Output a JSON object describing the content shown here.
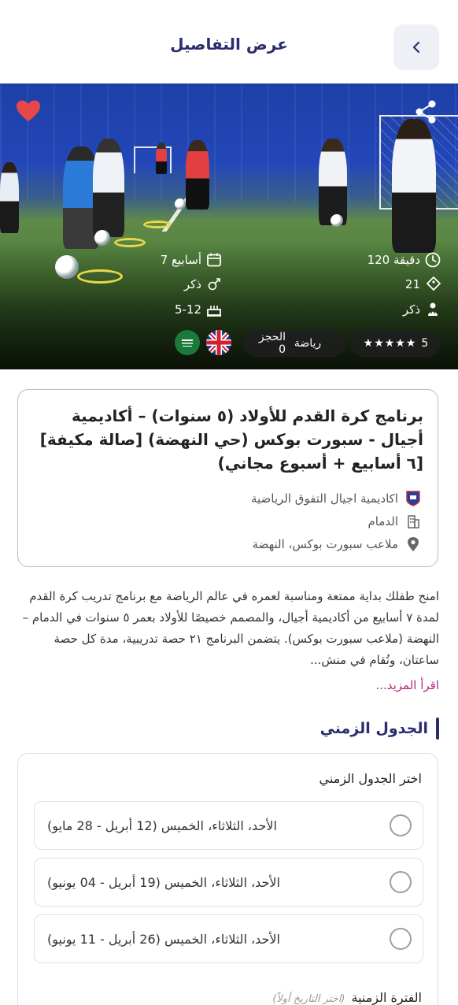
{
  "header": {
    "title": "عرض التفاصيل",
    "back_icon": "chevron-left-icon"
  },
  "hero": {
    "duration": "120 دقيقة",
    "weeks": "7 أسابيع",
    "count": "21",
    "gender_1": "ذكر",
    "gender_2": "ذكر",
    "age_range": "5-12",
    "rating": "5",
    "stars": "★★★★★",
    "category": "رياضة",
    "bookings": "الحجز 0",
    "favorite_color": "#e8474a"
  },
  "info": {
    "title": "برنامج كرة القدم للأولاد (٥ سنوات) – أكاديمية أجيال - سبورت بوكس (حي النهضة) [صالة مكيفة] [٦ أسابيع + أسبوع مجاني)",
    "academy": "اكاديمية اجيال التفوق الرياضية",
    "city": "الدمام",
    "venue": "ملاعب سبورت بوكس، النهضة"
  },
  "description": {
    "text": "امنح طفلك بداية ممتعة ومناسبة لعمره في عالم الرياضة مع برنامج تدريب كرة القدم لمدة ٧ أسابيع من أكاديمية أجيال، والمصمم خصيصًا للأولاد بعمر ٥ سنوات في الدمام – النهضة (ملاعب سبورت بوكس). يتضمن البرنامج ٢١ حصة تدريبية، مدة كل حصة ساعتان، وتُقام في منش...",
    "read_more": "اقرأ المزيد..."
  },
  "schedule": {
    "section_title": "الجدول الزمني",
    "choose_label": "اختر الجدول الزمني",
    "options": [
      "الأحد، الثلاثاء، الخميس (12 أبريل - 28 مايو)",
      "الأحد، الثلاثاء، الخميس (19 أبريل - 04 يونيو)",
      "الأحد، الثلاثاء، الخميس (26 أبريل - 11 يونيو)"
    ],
    "period_label": "الفترة الزمنية",
    "period_hint": "(اختر التاريخ أولاً)"
  }
}
